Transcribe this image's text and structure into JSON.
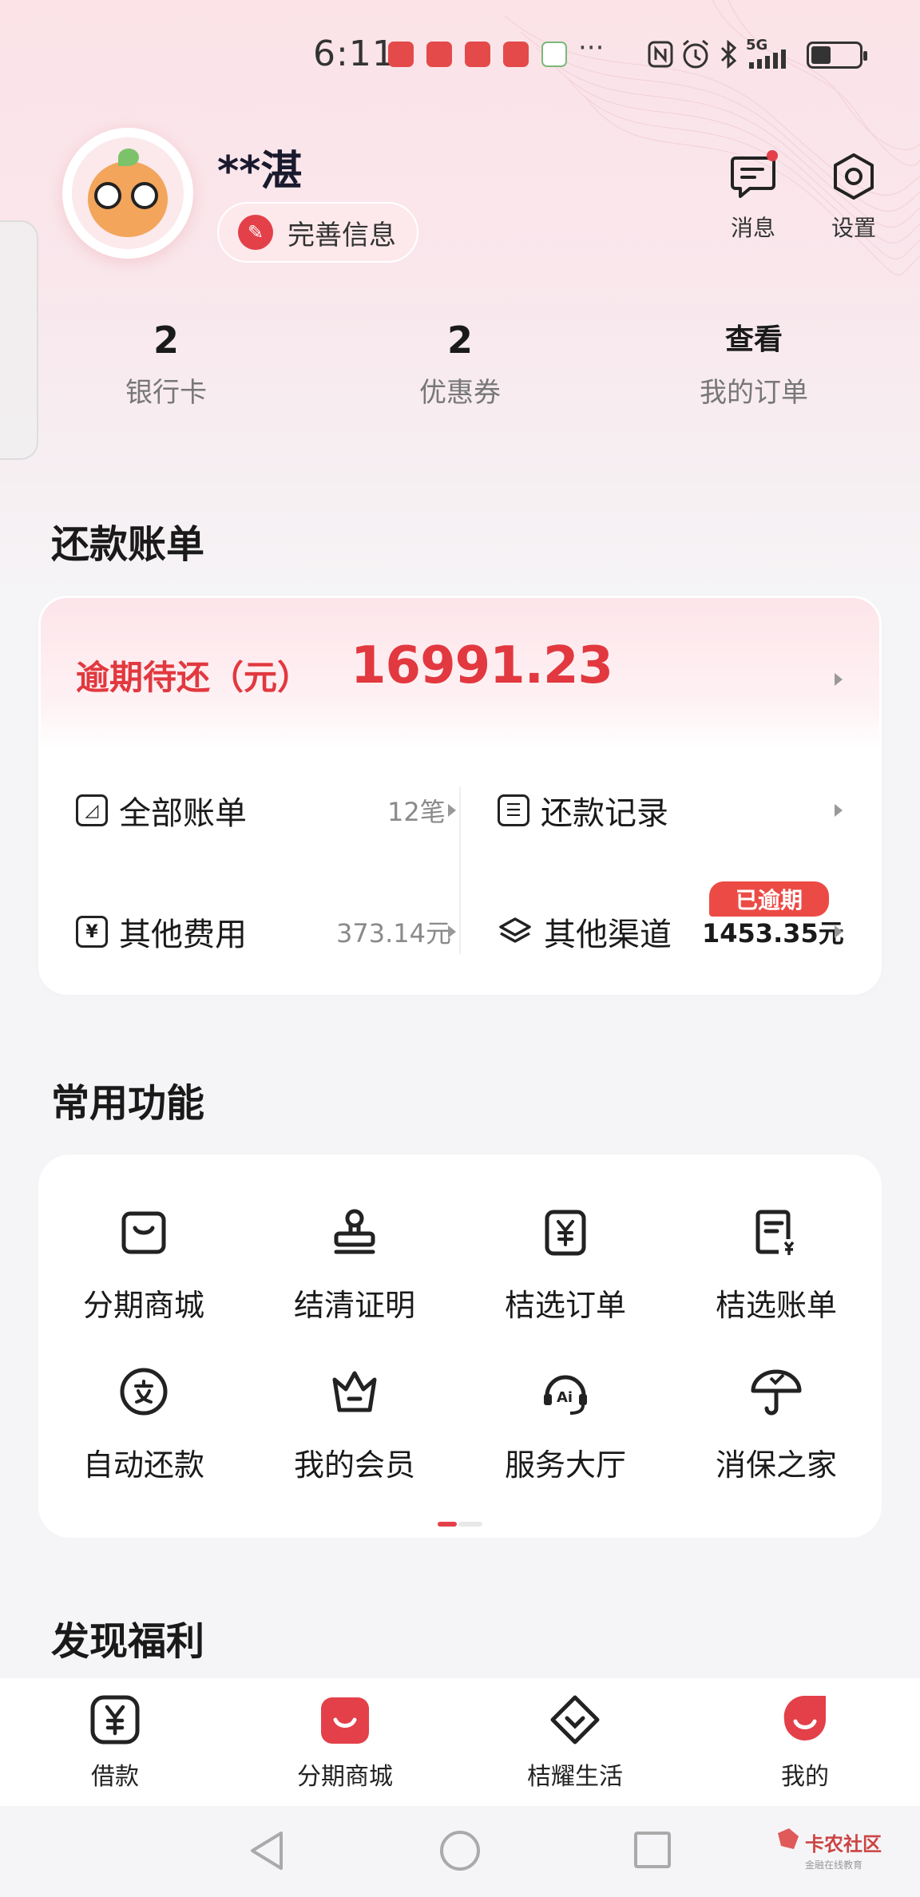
{
  "status_bar": {
    "time": "6:11",
    "network": "5G",
    "more": "···"
  },
  "profile": {
    "username": "**湛",
    "complete_info_label": "完善信息"
  },
  "top_actions": {
    "messages_label": "消息",
    "settings_label": "设置"
  },
  "stats": [
    {
      "value": "2",
      "label": "银行卡"
    },
    {
      "value": "2",
      "label": "优惠券"
    },
    {
      "value": "查看",
      "label": "我的订单"
    }
  ],
  "repayment": {
    "section_title": "还款账单",
    "overdue_label": "逾期待还（元）",
    "overdue_amount": "16991.23",
    "items": [
      {
        "label": "全部账单",
        "value": "12笔",
        "icon": "calendar-icon"
      },
      {
        "label": "还款记录",
        "value": "",
        "icon": "list-icon"
      },
      {
        "label": "其他费用",
        "value": "373.14元",
        "icon": "yuan-receipt-icon"
      },
      {
        "label": "其他渠道",
        "value": "1453.35元",
        "icon": "layers-icon",
        "badge": "已逾期"
      }
    ]
  },
  "functions": {
    "section_title": "常用功能",
    "items": [
      {
        "label": "分期商城",
        "icon": "shopping-bag-icon"
      },
      {
        "label": "结清证明",
        "icon": "stamp-icon"
      },
      {
        "label": "桔选订单",
        "icon": "yuan-doc-icon"
      },
      {
        "label": "桔选账单",
        "icon": "bill-yuan-icon"
      },
      {
        "label": "自动还款",
        "icon": "auto-repay-icon"
      },
      {
        "label": "我的会员",
        "icon": "crown-icon"
      },
      {
        "label": "服务大厅",
        "icon": "ai-headset-icon"
      },
      {
        "label": "消保之家",
        "icon": "umbrella-icon"
      }
    ],
    "page_index": 1,
    "page_count": 2
  },
  "discover": {
    "section_title": "发现福利"
  },
  "tabbar": [
    {
      "label": "借款",
      "icon": "loan-yuan-icon",
      "active": false
    },
    {
      "label": "分期商城",
      "icon": "mall-icon",
      "active": false
    },
    {
      "label": "桔耀生活",
      "icon": "life-icon",
      "active": false
    },
    {
      "label": "我的",
      "icon": "profile-icon",
      "active": true
    }
  ],
  "watermark": {
    "title": "卡农社区",
    "subtitle": "金融在线教育"
  },
  "colors": {
    "accent": "#e3404a",
    "overdue": "#e2383f",
    "badge": "#ec4b45",
    "background": "#f5f5f7"
  }
}
